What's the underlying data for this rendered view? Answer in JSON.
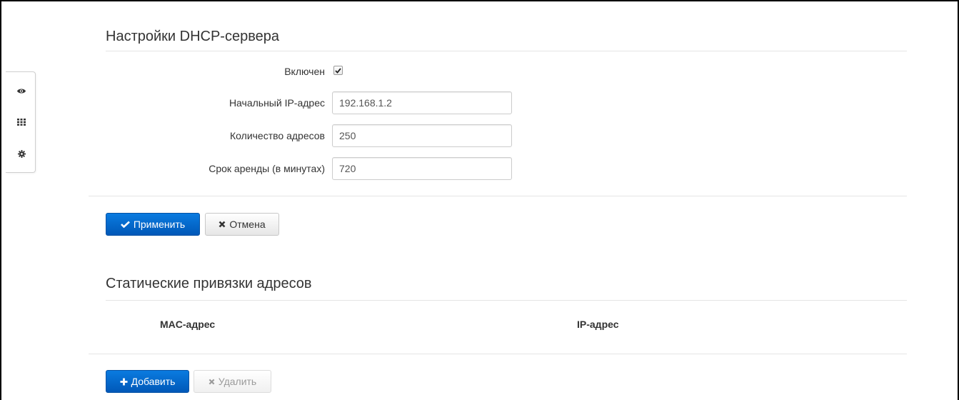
{
  "dhcp": {
    "title": "Настройки DHCP-сервера",
    "enabled_label": "Включен",
    "enabled": true,
    "start_ip_label": "Начальный IP-адрес",
    "start_ip_value": "192.168.1.2",
    "count_label": "Количество адресов",
    "count_value": "250",
    "lease_label": "Срок аренды (в минутах)",
    "lease_value": "720",
    "apply_label": "Применить",
    "cancel_label": "Отмена"
  },
  "static": {
    "title": "Статические привязки адресов",
    "columns": [
      "MAC-адрес",
      "IP-адрес"
    ],
    "add_label": "Добавить",
    "delete_label": "Удалить"
  },
  "sidebar": {
    "icons": [
      "eye-icon",
      "grid-icon",
      "gear-icon"
    ]
  },
  "colors": {
    "primary": "#0a6fd4",
    "border": "#e5e5e5"
  }
}
